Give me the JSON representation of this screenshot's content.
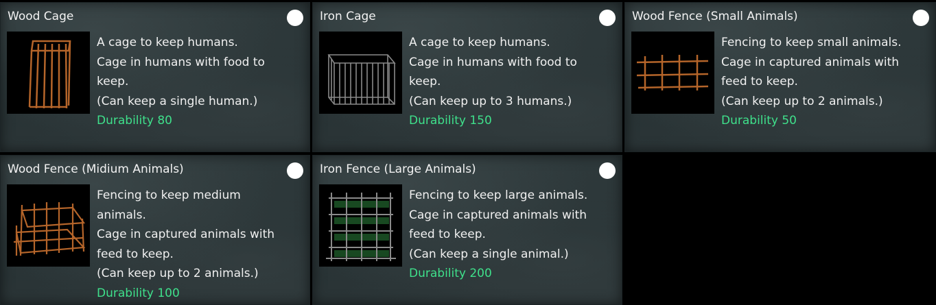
{
  "cards": [
    {
      "title": "Wood Cage",
      "image_icon": "wood-cage-icon",
      "lines": [
        "A cage to keep humans.",
        "Cage in humans with food to",
        "keep.",
        "(Can keep a single human.)"
      ],
      "durability": "Durability 80"
    },
    {
      "title": "Iron Cage",
      "image_icon": "iron-cage-icon",
      "lines": [
        "A cage to keep humans.",
        "Cage in humans with food to",
        "keep.",
        "(Can keep up to 3 humans.)"
      ],
      "durability": "Durability 150"
    },
    {
      "title": "Wood Fence (Small Animals)",
      "image_icon": "wood-fence-small-icon",
      "lines": [
        "Fencing to keep small animals.",
        "Cage in captured animals with",
        "feed to keep.",
        "(Can keep up to 2 animals.)"
      ],
      "durability": "Durability 50"
    },
    {
      "title": "Wood Fence (Midium Animals)",
      "image_icon": "wood-fence-medium-icon",
      "lines": [
        "Fencing to keep medium",
        "animals.",
        "Cage in captured animals with",
        "feed to keep.",
        "(Can keep up to 2 animals.)"
      ],
      "durability": "Durability 100"
    },
    {
      "title": "Iron Fence (Large Animals)",
      "image_icon": "iron-fence-large-icon",
      "lines": [
        "Fencing to keep large animals.",
        "Cage in captured animals with",
        "feed to keep.",
        "(Can keep a single animal.)"
      ],
      "durability": "Durability 200"
    }
  ],
  "colors": {
    "durability": "#3fe08b",
    "wood": "#b5652a",
    "iron": "#8a8a8a"
  }
}
